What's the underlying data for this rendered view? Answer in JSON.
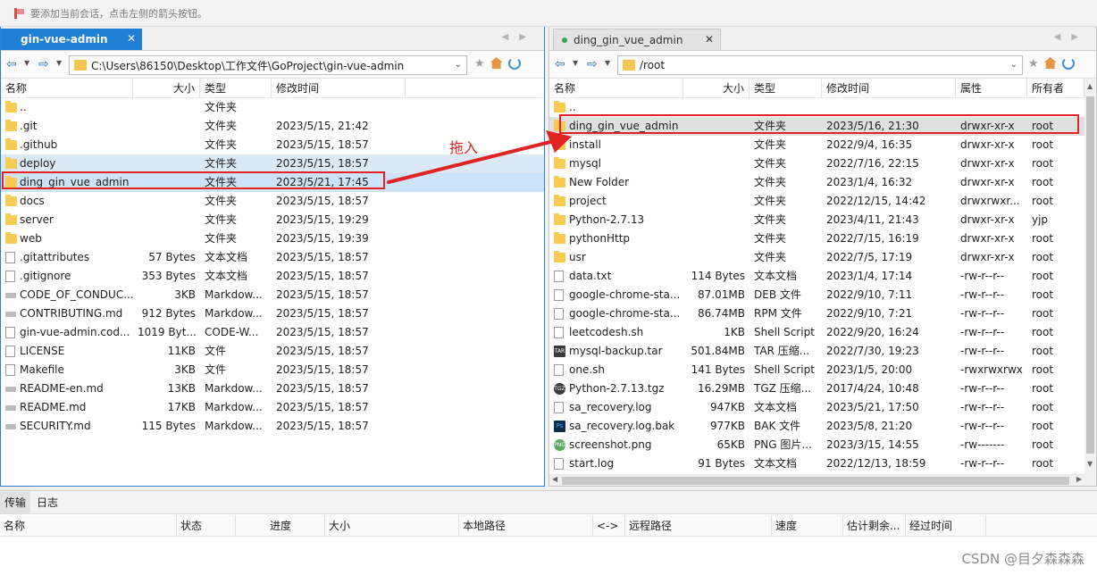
{
  "notice": "要添加当前会话，点击左侧的箭头按钮。",
  "left": {
    "tab": "gin-vue-admin",
    "path": "C:\\Users\\86150\\Desktop\\工作文件\\GoProject\\gin-vue-admin",
    "columns": [
      "名称",
      "大小",
      "类型",
      "修改时间"
    ],
    "rows": [
      {
        "icon": "folder",
        "name": "..",
        "size": "",
        "type": "文件夹",
        "modified": ""
      },
      {
        "icon": "folder",
        "name": ".git",
        "size": "",
        "type": "文件夹",
        "modified": "2023/5/15, 21:42"
      },
      {
        "icon": "folder",
        "name": ".github",
        "size": "",
        "type": "文件夹",
        "modified": "2023/5/15, 18:57"
      },
      {
        "icon": "folder",
        "name": "deploy",
        "size": "",
        "type": "文件夹",
        "modified": "2023/5/15, 18:57"
      },
      {
        "icon": "folder",
        "name": "ding_gin_vue_admin",
        "size": "",
        "type": "文件夹",
        "modified": "2023/5/21, 17:45"
      },
      {
        "icon": "folder",
        "name": "docs",
        "size": "",
        "type": "文件夹",
        "modified": "2023/5/15, 18:57"
      },
      {
        "icon": "folder",
        "name": "server",
        "size": "",
        "type": "文件夹",
        "modified": "2023/5/15, 19:29"
      },
      {
        "icon": "folder",
        "name": "web",
        "size": "",
        "type": "文件夹",
        "modified": "2023/5/15, 19:39"
      },
      {
        "icon": "doc",
        "name": ".gitattributes",
        "size": "57 Bytes",
        "type": "文本文档",
        "modified": "2023/5/15, 18:57"
      },
      {
        "icon": "doc",
        "name": ".gitignore",
        "size": "353 Bytes",
        "type": "文本文档",
        "modified": "2023/5/15, 18:57"
      },
      {
        "icon": "md",
        "name": "CODE_OF_CONDUC...",
        "size": "3KB",
        "type": "Markdow...",
        "modified": "2023/5/15, 18:57"
      },
      {
        "icon": "md",
        "name": "CONTRIBUTING.md",
        "size": "912 Bytes",
        "type": "Markdow...",
        "modified": "2023/5/15, 18:57"
      },
      {
        "icon": "doc",
        "name": "gin-vue-admin.cod...",
        "size": "1019 Byt...",
        "type": "CODE-W...",
        "modified": "2023/5/15, 18:57"
      },
      {
        "icon": "doc",
        "name": "LICENSE",
        "size": "11KB",
        "type": "文件",
        "modified": "2023/5/15, 18:57"
      },
      {
        "icon": "doc",
        "name": "Makefile",
        "size": "3KB",
        "type": "文件",
        "modified": "2023/5/15, 18:57"
      },
      {
        "icon": "md",
        "name": "README-en.md",
        "size": "13KB",
        "type": "Markdow...",
        "modified": "2023/5/15, 18:57"
      },
      {
        "icon": "md",
        "name": "README.md",
        "size": "17KB",
        "type": "Markdow...",
        "modified": "2023/5/15, 18:57"
      },
      {
        "icon": "md",
        "name": "SECURITY.md",
        "size": "115 Bytes",
        "type": "Markdow...",
        "modified": "2023/5/15, 18:57"
      }
    ]
  },
  "right": {
    "tab": "ding_gin_vue_admin",
    "path": "/root",
    "columns": [
      "名称",
      "大小",
      "类型",
      "修改时间",
      "属性",
      "所有者"
    ],
    "rows": [
      {
        "icon": "folder",
        "name": "..",
        "size": "",
        "type": "",
        "modified": "",
        "perm": "",
        "owner": ""
      },
      {
        "icon": "folder",
        "name": "ding_gin_vue_admin",
        "size": "",
        "type": "文件夹",
        "modified": "2023/5/16, 21:30",
        "perm": "drwxr-xr-x",
        "owner": "root"
      },
      {
        "icon": "folder",
        "name": "install",
        "size": "",
        "type": "文件夹",
        "modified": "2022/9/4, 16:35",
        "perm": "drwxr-xr-x",
        "owner": "root"
      },
      {
        "icon": "folder",
        "name": "mysql",
        "size": "",
        "type": "文件夹",
        "modified": "2022/7/16, 22:15",
        "perm": "drwxr-xr-x",
        "owner": "root"
      },
      {
        "icon": "folder",
        "name": "New Folder",
        "size": "",
        "type": "文件夹",
        "modified": "2023/1/4, 16:32",
        "perm": "drwxr-xr-x",
        "owner": "root"
      },
      {
        "icon": "folder",
        "name": "project",
        "size": "",
        "type": "文件夹",
        "modified": "2022/12/15, 14:42",
        "perm": "drwxrwxr...",
        "owner": "root"
      },
      {
        "icon": "folder",
        "name": "Python-2.7.13",
        "size": "",
        "type": "文件夹",
        "modified": "2023/4/11, 21:43",
        "perm": "drwxr-xr-x",
        "owner": "yjp"
      },
      {
        "icon": "folder",
        "name": "pythonHttp",
        "size": "",
        "type": "文件夹",
        "modified": "2022/7/15, 16:19",
        "perm": "drwxr-xr-x",
        "owner": "root"
      },
      {
        "icon": "folder",
        "name": "usr",
        "size": "",
        "type": "文件夹",
        "modified": "2022/7/5, 17:19",
        "perm": "drwxr-xr-x",
        "owner": "root"
      },
      {
        "icon": "doc",
        "name": "data.txt",
        "size": "114 Bytes",
        "type": "文本文档",
        "modified": "2023/1/4, 17:14",
        "perm": "-rw-r--r--",
        "owner": "root"
      },
      {
        "icon": "doc",
        "name": "google-chrome-sta...",
        "size": "87.01MB",
        "type": "DEB 文件",
        "modified": "2022/9/10, 7:11",
        "perm": "-rw-r--r--",
        "owner": "root"
      },
      {
        "icon": "doc",
        "name": "google-chrome-sta...",
        "size": "86.74MB",
        "type": "RPM 文件",
        "modified": "2022/9/10, 7:21",
        "perm": "-rw-r--r--",
        "owner": "root"
      },
      {
        "icon": "doc",
        "name": "leetcodesh.sh",
        "size": "1KB",
        "type": "Shell Script",
        "modified": "2022/9/20, 16:24",
        "perm": "-rw-r--r--",
        "owner": "root"
      },
      {
        "icon": "tar",
        "name": "mysql-backup.tar",
        "size": "501.84MB",
        "type": "TAR 压缩...",
        "modified": "2022/7/30, 19:23",
        "perm": "-rw-r--r--",
        "owner": "root"
      },
      {
        "icon": "doc",
        "name": "one.sh",
        "size": "141 Bytes",
        "type": "Shell Script",
        "modified": "2023/1/5, 20:00",
        "perm": "-rwxrwxrwx",
        "owner": "root"
      },
      {
        "icon": "tgz",
        "name": "Python-2.7.13.tgz",
        "size": "16.29MB",
        "type": "TGZ 压缩...",
        "modified": "2017/4/24, 10:48",
        "perm": "-rw-r--r--",
        "owner": "root"
      },
      {
        "icon": "doc",
        "name": "sa_recovery.log",
        "size": "947KB",
        "type": "文本文档",
        "modified": "2023/5/21, 17:50",
        "perm": "-rw-r--r--",
        "owner": "root"
      },
      {
        "icon": "ps",
        "name": "sa_recovery.log.bak",
        "size": "977KB",
        "type": "BAK 文件",
        "modified": "2023/5/8, 21:20",
        "perm": "-rw-r--r--",
        "owner": "root"
      },
      {
        "icon": "png",
        "name": "screenshot.png",
        "size": "65KB",
        "type": "PNG 图片...",
        "modified": "2023/3/15, 14:55",
        "perm": "-rw-------",
        "owner": "root"
      },
      {
        "icon": "doc",
        "name": "start.log",
        "size": "91 Bytes",
        "type": "文本文档",
        "modified": "2022/12/13, 18:59",
        "perm": "-rw-r--r--",
        "owner": "root"
      }
    ]
  },
  "annotation": "拖入",
  "log_tabs": [
    "传输",
    "日志"
  ],
  "log_columns": [
    "名称",
    "状态",
    "进度",
    "大小",
    "本地路径",
    "<->",
    "远程路径",
    "速度",
    "估计剩余...",
    "经过时间"
  ],
  "watermark": "CSDN @目夕森森森",
  "colors": {
    "accent": "#1e7fd4",
    "annotation": "#e02424",
    "folder": "#f6cc55"
  }
}
